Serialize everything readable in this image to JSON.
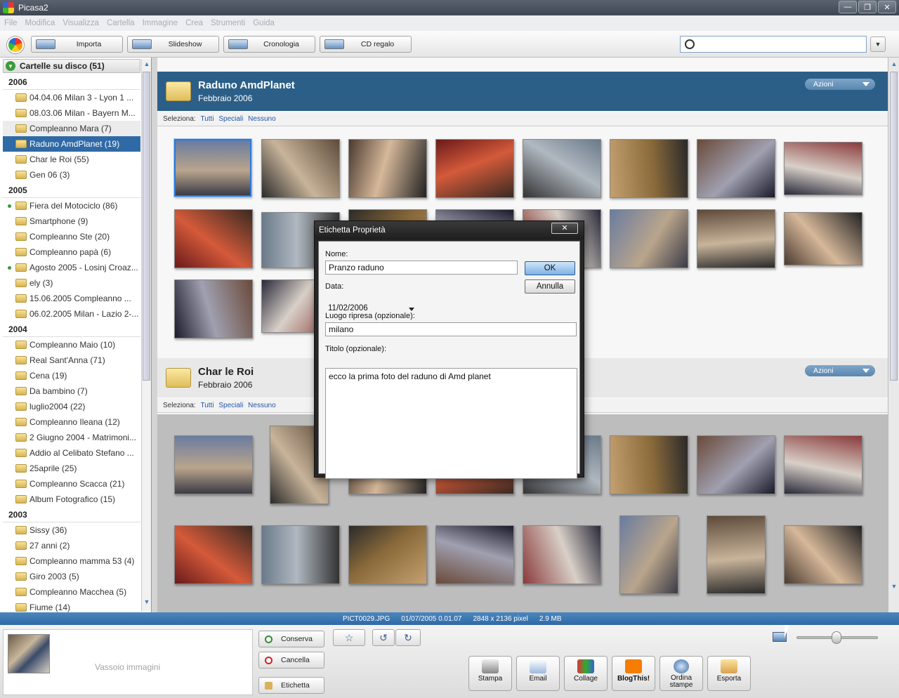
{
  "window": {
    "title": "Picasa2"
  },
  "menu": [
    "File",
    "Modifica",
    "Visualizza",
    "Cartella",
    "Immagine",
    "Crea",
    "Strumenti",
    "Guida"
  ],
  "toolbar": {
    "buttons": [
      "Importa",
      "Slideshow",
      "Cronologia",
      "CD regalo"
    ],
    "search_placeholder": ""
  },
  "sidebar": {
    "header": "Cartelle su disco (51)",
    "groups": [
      {
        "year": "2006",
        "items": [
          "04.04.06 Milan 3 - Lyon 1 ...",
          "08.03.06 Milan - Bayern M...",
          "Compleanno Mara (7)",
          "Raduno AmdPlanet (19)",
          "Char le Roi (55)",
          "Gen 06 (3)"
        ]
      },
      {
        "year": "2005",
        "items": [
          "Fiera del Motociclo (86)",
          "Smartphone (9)",
          "Compleanno Ste (20)",
          "Compleanno papà (6)",
          "Agosto 2005 - Losinj Croaz...",
          "ely (3)",
          "15.06.2005 Compleanno ...",
          "06.02.2005 Milan - Lazio 2-..."
        ]
      },
      {
        "year": "2004",
        "items": [
          "Compleanno Maio (10)",
          "Real Sant'Anna (71)",
          "Cena (19)",
          "Da bambino (7)",
          "luglio2004 (22)",
          "Compleanno Ileana (12)",
          "2 Giugno 2004 - Matrimoni...",
          "Addio al Celibato Stefano ...",
          "25aprile (25)",
          "Compleanno Scacca (21)",
          "Album Fotografico (15)"
        ]
      },
      {
        "year": "2003",
        "items": [
          "Sissy (36)",
          "27 anni (2)",
          "Compleanno mamma 53 (4)",
          "Giro 2003 (5)",
          "Compleanno Macchea (5)",
          "Fiume (14)"
        ]
      }
    ],
    "selected": "Raduno AmdPlanet (19)"
  },
  "albums": [
    {
      "title": "Raduno AmdPlanet",
      "date": "Febbraio 2006",
      "actions": "Azioni"
    },
    {
      "title": "Char le Roi",
      "date": "Febbraio 2006",
      "actions": "Azioni"
    }
  ],
  "selection_bar": {
    "label": "Seleziona:",
    "all": "Tutti",
    "special": "Speciali",
    "none": "Nessuno"
  },
  "dialog": {
    "title": "Etichetta Proprietà",
    "close": "✕",
    "name_label": "Nome:",
    "name_value": "Pranzo raduno",
    "ok": "OK",
    "cancel": "Annulla",
    "date_label": "Data:",
    "date_value": "11/02/2006",
    "place_label": "Luogo ripresa (opzionale):",
    "place_value": "milano",
    "caption_label": "Titolo (opzionale):",
    "caption_value": "ecco la prima foto del raduno di Amd planet"
  },
  "status": {
    "file": "PICT0029.JPG",
    "date": "01/07/2005 0.01.07",
    "dims": "2848 x 2136 pixel",
    "size": "2.9 MB"
  },
  "tray": {
    "label": "Vassoio immagini",
    "keep": "Conserva",
    "clear": "Cancella",
    "label_btn": "Etichetta"
  },
  "actions": [
    "Stampa",
    "Email",
    "Collage",
    "BlogThis!",
    "Ordina stampe",
    "Esporta"
  ],
  "colors": {
    "accent": "#2f6aa6",
    "album_header": "#2c5f87",
    "status_bar": "#2f6aa6"
  }
}
